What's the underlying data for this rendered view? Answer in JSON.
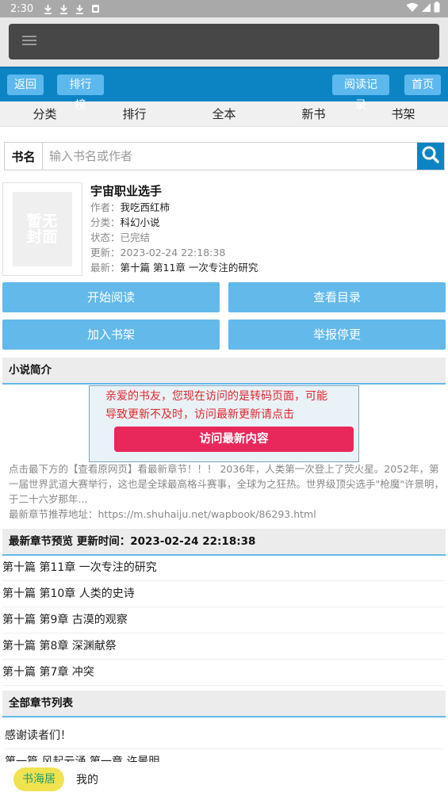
{
  "status_bar": {
    "time": "2:30"
  },
  "top_nav": {
    "back": "返回",
    "rank": "排行榜",
    "history": "阅读记录",
    "home": "首页"
  },
  "categories": [
    "分类",
    "排行",
    "全本",
    "新书",
    "书架"
  ],
  "search": {
    "label": "书名",
    "placeholder": "输入书名或作者"
  },
  "book": {
    "cover_text_1": "暂无",
    "cover_text_2": "封面",
    "title": "宇宙职业选手",
    "author_label": "作者：",
    "author": "我吃西红柿",
    "category_label": "分类：",
    "category": "科幻小说",
    "status_label": "状态：",
    "status": "已完结",
    "updated_label": "更新：",
    "updated": "2023-02-24 22:18:38",
    "latest_label": "最新：",
    "latest": "第十篇 第11章 一次专注的研究"
  },
  "actions": {
    "start": "开始阅读",
    "toc": "查看目录",
    "shelf": "加入书架",
    "report": "举报停更"
  },
  "intro_section": {
    "title": "小说简介"
  },
  "notice": {
    "line1": "亲爱的书友，您现在访问的是转码页面，可能",
    "line2": "导致更新不及时，访问最新更新请点击",
    "button": "访问最新内容"
  },
  "intro": {
    "text": "点击最下方的【查看原网页】看最新章节！！！ 2036年，人类第一次登上了荧火星。2052年，第一届世界武道大赛举行，这也是全球最高格斗赛事，全球为之狂热。世界级顶尖选手\"枪魔\"许景明，于二十六岁那年...",
    "recommend": "最新章节推荐地址：https://m.shuhaiju.net/wapbook/86293.html"
  },
  "latest_section": {
    "title": "最新章节预览 更新时间：2023-02-24 22:18:38"
  },
  "latest_chapters": [
    "第十篇 第11章 一次专注的研究",
    "第十篇 第10章 人类的史诗",
    "第十篇 第9章 古漠的观察",
    "第十篇 第8章 深渊献祭",
    "第十篇 第7章 冲突"
  ],
  "all_section": {
    "title": "全部章节列表"
  },
  "all_chapters": [
    "感谢读者们！",
    "第一篇 风起云涌 第一章 许景明"
  ],
  "bottom_bar": {
    "home": "书海居",
    "me": "我的"
  },
  "colors": {
    "nav_blue": "#0c84c4",
    "button_blue": "#62b9ea",
    "notice_red": "#e0282d",
    "visit_button": "#e8285b",
    "home_tab": "#f1e24f"
  },
  "icons": [
    "download-icon",
    "sim-icon",
    "wifi-icon",
    "signal-icon",
    "battery-icon",
    "menu-icon",
    "search-icon"
  ]
}
